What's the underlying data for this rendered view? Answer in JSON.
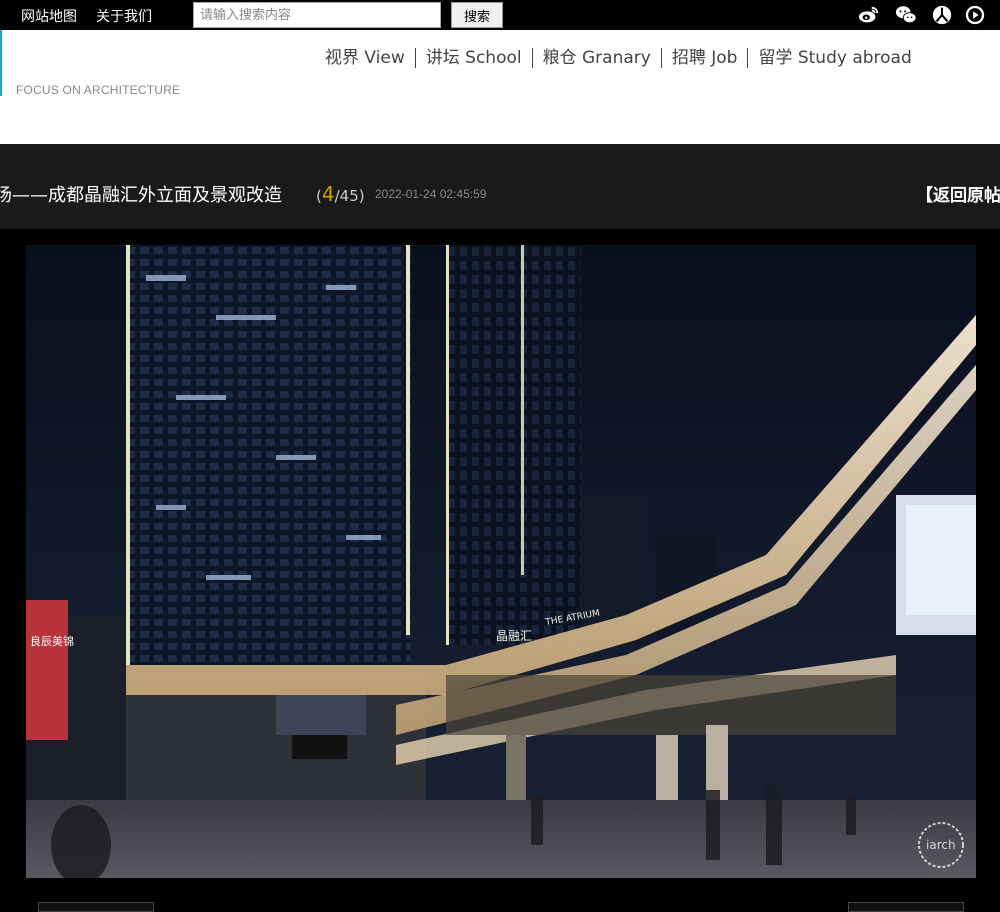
{
  "topbar": {
    "sitemap_label": "网站地图",
    "about_label": "关于我们",
    "search_placeholder": "请输入搜索内容",
    "search_button": "搜索",
    "social_icons": [
      "weibo-icon",
      "wechat-icon",
      "renren-icon",
      "play-icon"
    ]
  },
  "header": {
    "tagline": "FOCUS ON ARCHITECTURE",
    "nav": [
      {
        "label": "视界 View"
      },
      {
        "label": "讲坛 School"
      },
      {
        "label": "粮仓 Granary"
      },
      {
        "label": "招聘 Job"
      },
      {
        "label": "留学 Study abroad"
      }
    ]
  },
  "post": {
    "title": "场——成都晶融汇外立面及景观改造",
    "counter_open": "(",
    "counter_current": "4",
    "counter_total": "/45)",
    "date": "2022-01-24 02:45:59",
    "back_label": "【返回原帖"
  },
  "photo": {
    "sign_text": "THE ATRIUM",
    "sign_cn": "晶融汇",
    "left_sign": "良辰美锦",
    "watermark": "iarch"
  },
  "colors": {
    "accent": "#1aa6d8",
    "counter": "#c9a000",
    "titlebar_bg": "#1a1a1a"
  }
}
